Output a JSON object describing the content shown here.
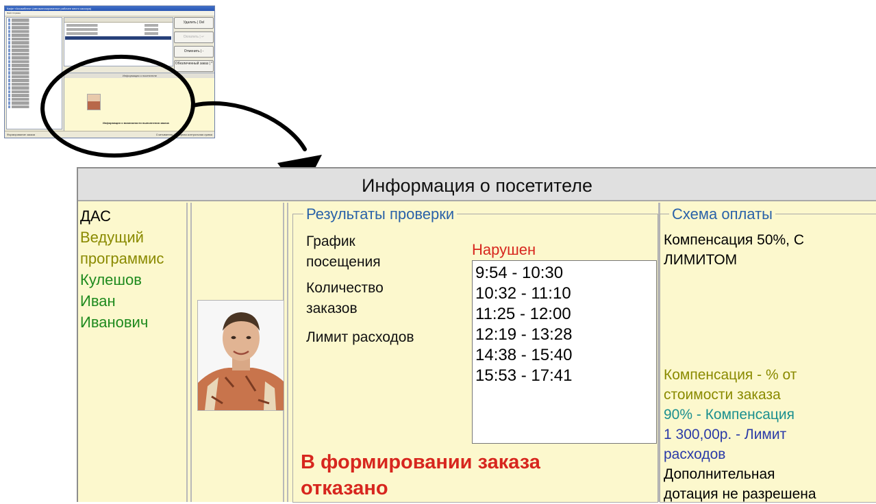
{
  "thumbnail": {
    "window_title": "Кафе «Ассамблея» (автоматизированное рабочее место кассира)",
    "menu": "Файл   Справка",
    "buttons": [
      {
        "label": "Удалить | Del",
        "enabled": true
      },
      {
        "label": "Оплатить | ↵",
        "enabled": false
      },
      {
        "label": "Отменить | -",
        "enabled": true
      },
      {
        "label": "Обезличенный заказ | *",
        "enabled": true
      }
    ],
    "info_header": "Информация о посетителе",
    "info_deny": "Информация о возможности выполнения заказа",
    "status_left": "Формирование заказа",
    "status_right": "Считыватель: Неверная контрольная сумма"
  },
  "panel": {
    "title": "Информация о посетителе",
    "visitor": {
      "login": "ДАС",
      "position": [
        "Ведущий",
        "программис"
      ],
      "full_name": [
        "Кулешов",
        "Иван",
        "Иванович"
      ]
    },
    "check": {
      "title": "Результаты проверки",
      "labels": {
        "schedule_1": "График",
        "schedule_2": "посещения",
        "orders_1": "Количество",
        "orders_2": "заказов",
        "limit": "Лимит расходов"
      },
      "schedule_status": "Нарушен",
      "intervals": [
        "9:54 - 10:30",
        "10:32 - 11:10",
        "11:25 - 12:00",
        "12:19 - 13:28",
        "14:38 - 15:40",
        "15:53 - 17:41"
      ],
      "denied_1": "В формировании заказа",
      "denied_2": "отказано"
    },
    "payment": {
      "title": "Схема оплаты",
      "scheme_1": "Компенсация 50%, С",
      "scheme_2": "ЛИМИТОМ",
      "desc_1": "Компенсация - % от",
      "desc_2": "стоимости заказа",
      "comp": "90% - Компенсация",
      "limit_1": "1 300,00р. - Лимит",
      "limit_2": "расходов",
      "extra_1": "Дополнительная",
      "extra_2": "дотация не разрешена"
    }
  },
  "colors": {
    "panel_bg": "#fcf8cd",
    "group_title": "#2a62a8",
    "violation": "#d7261e",
    "position_text": "#8a8a00",
    "name_text": "#1e8a1e",
    "teal_text": "#1a8f8f",
    "limit_text": "#2a3aa8"
  }
}
